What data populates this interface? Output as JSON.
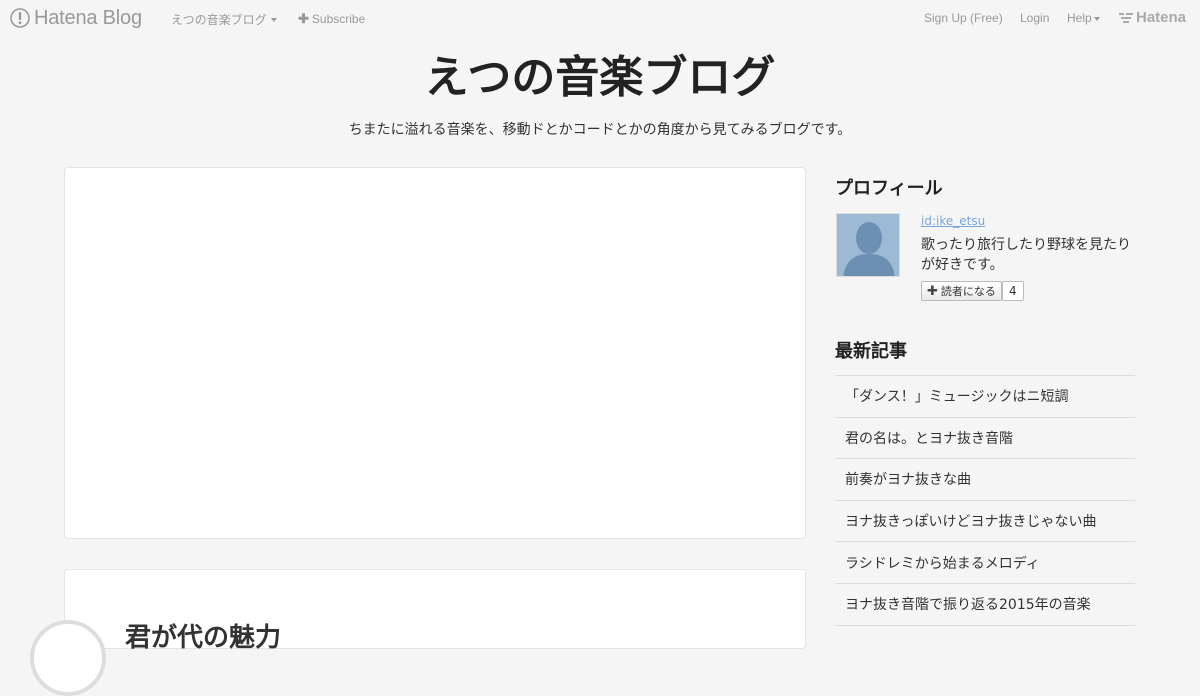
{
  "global_header": {
    "logo_text": "Hatena Blog",
    "blog_menu_label": "えつの音楽ブログ",
    "subscribe_label": "Subscribe",
    "signup_label": "Sign Up (Free)",
    "login_label": "Login",
    "help_label": "Help",
    "hatena_label": "Hatena"
  },
  "blog": {
    "title": "えつの音楽ブログ",
    "description": "ちまたに溢れる音楽を、移動ドとかコードとかの角度から見てみるブログです。"
  },
  "entry": {
    "title_partial": "君が代の魅力"
  },
  "sidebar": {
    "profile": {
      "heading": "プロフィール",
      "user_id": "id:ike_etsu",
      "description": "歌ったり旅行したり野球を見たりが好きです。",
      "reader_button_label": "読者になる",
      "reader_count": "4"
    },
    "recent": {
      "heading": "最新記事",
      "items": [
        "「ダンス！」ミュージックはニ短調",
        "君の名は。とヨナ抜き音階",
        "前奏がヨナ抜きな曲",
        "ヨナ抜きっぽいけどヨナ抜きじゃない曲",
        "ラシドレミから始まるメロディ",
        "ヨナ抜き音階で振り返る2015年の音楽"
      ]
    }
  }
}
